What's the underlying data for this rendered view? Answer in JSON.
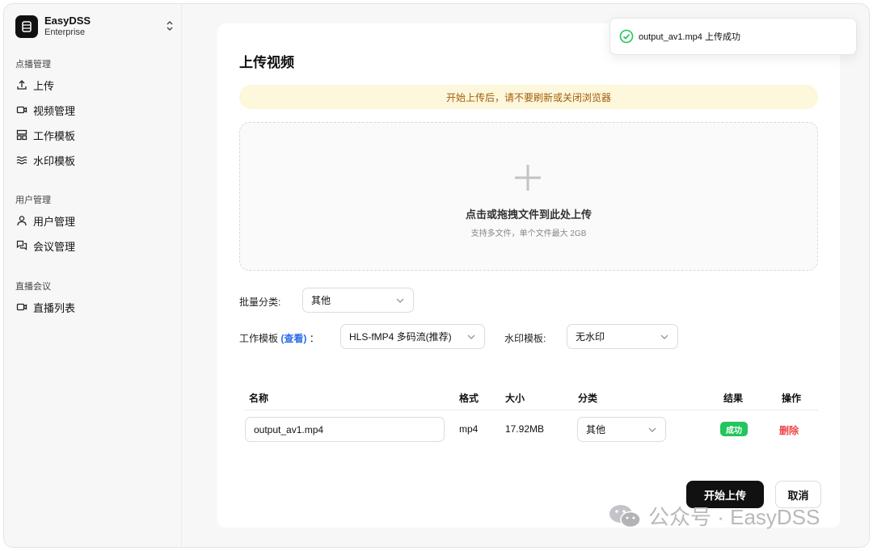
{
  "brand": {
    "name": "EasyDSS",
    "edition": "Enterprise"
  },
  "sidebar": {
    "groups": [
      {
        "title": "点播管理",
        "items": [
          {
            "label": "上传",
            "icon": "upload-icon"
          },
          {
            "label": "视频管理",
            "icon": "video-icon"
          },
          {
            "label": "工作模板",
            "icon": "template-icon"
          },
          {
            "label": "水印模板",
            "icon": "watermark-icon"
          }
        ]
      },
      {
        "title": "用户管理",
        "items": [
          {
            "label": "用户管理",
            "icon": "user-icon"
          },
          {
            "label": "会议管理",
            "icon": "meeting-icon"
          }
        ]
      },
      {
        "title": "直播会议",
        "items": [
          {
            "label": "直播列表",
            "icon": "video-icon"
          }
        ]
      }
    ]
  },
  "page": {
    "title": "上传视频",
    "notice": "开始上传后，请不要刷新或关闭浏览器",
    "dropzone": {
      "title": "点击或拖拽文件到此处上传",
      "subtitle": "支持多文件，单个文件最大 2GB"
    }
  },
  "form": {
    "batch_category_label": "批量分类:",
    "batch_category_value": "其他",
    "work_template_label": "工作模板",
    "work_template_link": "(查看)",
    "work_template_colon": "：",
    "work_template_value": "HLS-fMP4 多码流(推荐)",
    "watermark_label": "水印模板:",
    "watermark_value": "无水印"
  },
  "table": {
    "headers": {
      "name": "名称",
      "format": "格式",
      "size": "大小",
      "category": "分类",
      "result": "结果",
      "action": "操作"
    },
    "rows": [
      {
        "name": "output_av1.mp4",
        "format": "mp4",
        "size": "17.92MB",
        "category": "其他",
        "result": "成功",
        "action": "删除"
      }
    ]
  },
  "buttons": {
    "start_upload": "开始上传",
    "cancel": "取消"
  },
  "toast": {
    "message": "output_av1.mp4 上传成功"
  },
  "watermark": {
    "text": "公众号 · EasyDSS"
  },
  "colors": {
    "success": "#22c55e",
    "danger": "#ef4444",
    "link": "#2b6de8",
    "notice_bg": "#fdf7db",
    "primary": "#111111"
  }
}
